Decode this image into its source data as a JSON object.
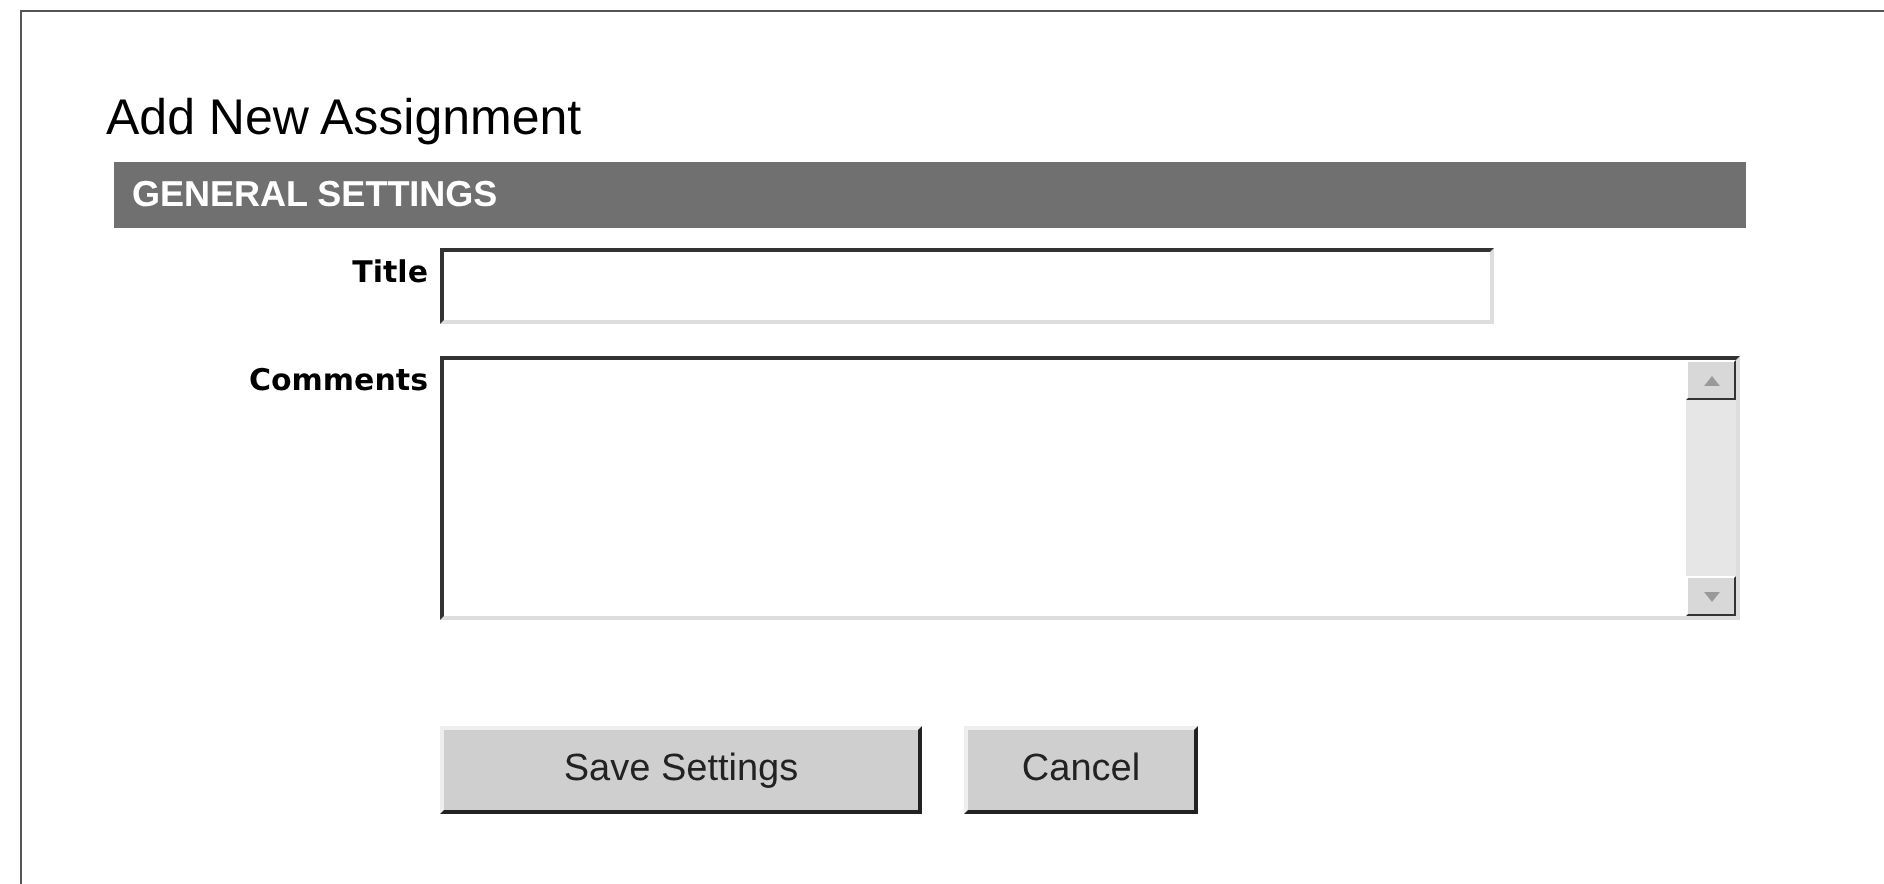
{
  "title": "Add New Assignment",
  "section": {
    "heading": "GENERAL SETTINGS"
  },
  "fields": [
    {
      "kind": "text",
      "label": "Title"
    },
    {
      "kind": "textarea",
      "label": "Comments"
    }
  ],
  "buttons": [
    "Save Settings",
    "Cancel"
  ]
}
